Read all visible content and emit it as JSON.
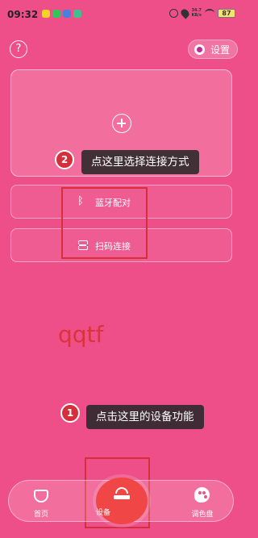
{
  "status_bar": {
    "time": "09:32",
    "net_speed_top": "34.7",
    "net_speed_bottom": "KB/s",
    "battery": "87"
  },
  "header": {
    "help_label": "?",
    "settings_label": "设置"
  },
  "connect_options": {
    "bluetooth_label": "蓝牙配对",
    "scan_label": "扫码连接"
  },
  "watermark": "qqtf",
  "tutorial": {
    "step1_number": "1",
    "step1_text": "点击这里的设备功能",
    "step2_number": "2",
    "step2_text": "点这里选择连接方式"
  },
  "bottom_nav": {
    "home_label": "首页",
    "device_label": "设备",
    "palette_label": "调色盘"
  },
  "colors": {
    "background": "#ee4f88",
    "accent_red": "#d52f3b",
    "device_active": "#f04646"
  },
  "icons": {
    "bluetooth": "ᛒ",
    "add": "plus-circle",
    "scan": "scan-frame"
  }
}
